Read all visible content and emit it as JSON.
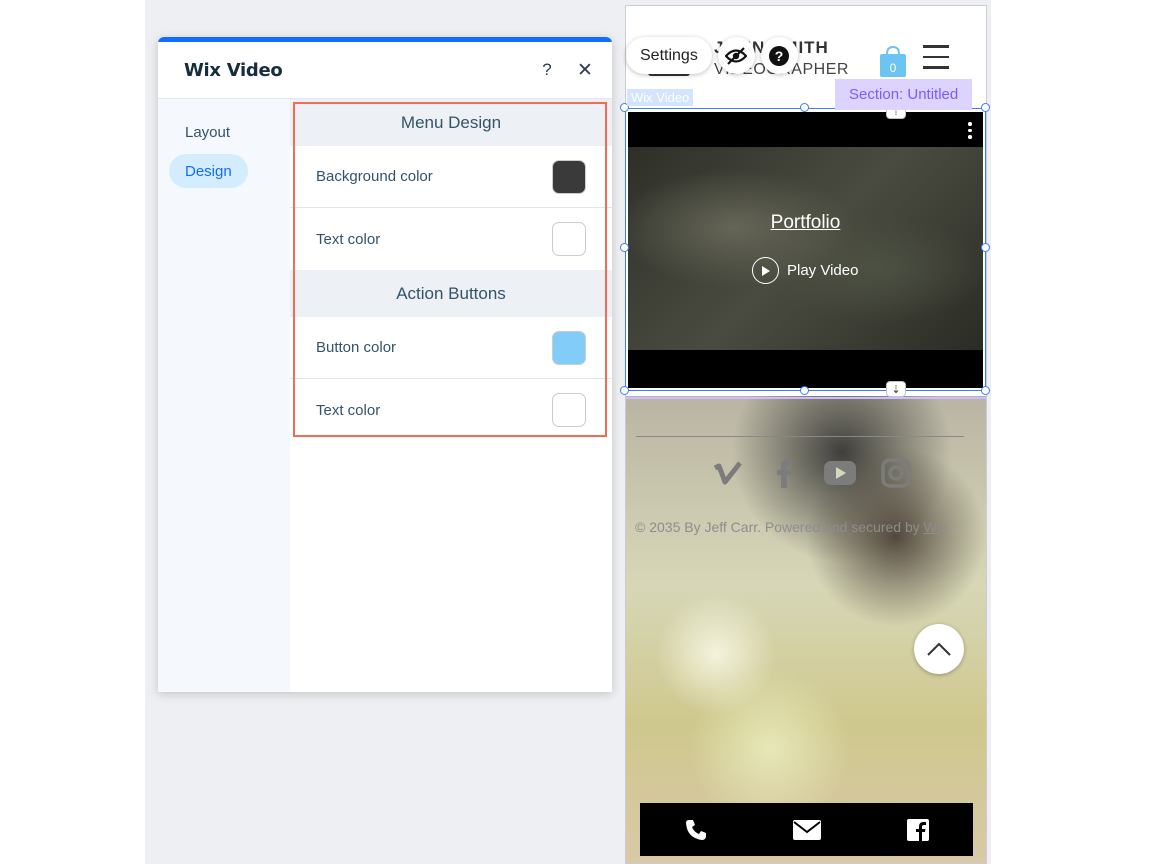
{
  "panel": {
    "title": "Wix Video",
    "help_label": "?",
    "close_label": "✕",
    "nav": [
      {
        "label": "Layout",
        "active": false
      },
      {
        "label": "Design",
        "active": true
      }
    ],
    "sections": [
      {
        "title": "Menu Design",
        "rows": [
          {
            "label": "Background color",
            "color": "#3a3a3a"
          },
          {
            "label": "Text color",
            "color": "#ffffff"
          }
        ]
      },
      {
        "title": "Action Buttons",
        "rows": [
          {
            "label": "Button color",
            "color": "#82cdf7"
          },
          {
            "label": "Text color",
            "color": "#ffffff"
          }
        ]
      }
    ]
  },
  "toolbar": {
    "settings_label": "Settings"
  },
  "site": {
    "brand_line1": "JOHN SMITH",
    "brand_line2": "VIDEOGRAPHER",
    "cart_count": "0",
    "element_label": "Wix Video",
    "section_label": "Section: Untitled",
    "video_title": "Portfolio",
    "play_label": "Play Video",
    "copyright_prefix": "© 2035 By Jeff Carr. Powered and secured by ",
    "copyright_link": "Wix",
    "socials": [
      "vimeo-icon",
      "facebook-icon",
      "youtube-icon",
      "instagram-icon"
    ],
    "actions": [
      "phone-icon",
      "email-icon",
      "facebook-icon"
    ]
  },
  "colors": {
    "accent": "#116dff",
    "highlight": "#f06d52",
    "selection": "#3d7cff",
    "section_purple": "#7a5cff"
  }
}
